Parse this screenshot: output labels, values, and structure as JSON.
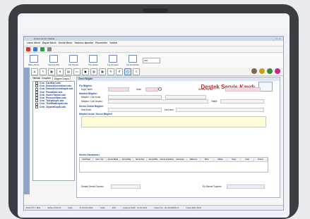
{
  "window": {
    "title": "Destek Servis Modülü",
    "controls": "_ □ ×"
  },
  "menu": [
    "Uzem Menü",
    "Bayan Menü",
    "Servis Menü",
    "Yardımcı İşlemler",
    "Pencereler",
    "Yardım"
  ],
  "ribbon": [
    {
      "label": "BEC-AŞ Aç",
      "icon": "open-icon"
    },
    {
      "label": "Fiş Kayıt/Sil",
      "icon": "record-icon"
    },
    {
      "label": "Fiş Kaydet",
      "icon": "save-icon"
    },
    {
      "label": "Fiş Listele",
      "icon": "list-icon"
    },
    {
      "label": "Fiş Sorgula",
      "icon": "query-icon"
    },
    {
      "label": "Fiş Görüntüle",
      "icon": "view-icon"
    }
  ],
  "ribbon_select": "200",
  "tabs": [
    "Tablolar",
    "Dosyalar",
    "Dizgem Dosya"
  ],
  "explorer": {
    "header": "",
    "files": [
      "Crm_CariKart.xds",
      "Crm_DestekServisKart.xds",
      "Crm_DestekServisKaydi.xds",
      "Crm_FirmaKart.xds",
      "Crm_GorevTanimi.xds",
      "Crm_PersonelKart.xds",
      "Crm_TalepKaydi.xds",
      "Crm_TeklifSatKaydi.xds",
      "Crm_ZiyaretKaydi.xds"
    ]
  },
  "form": {
    "header": "Genel Bilgiler",
    "title": "Destek Servis Kaydı",
    "sections": {
      "fis": "Fiş Bilgileri",
      "musteri": "Müşteri Bilgileri",
      "servis": "Servis Ürünü Bilgileri",
      "aciklama": "Müşteri Arıza / Sorun Bilgileri",
      "hareket": "Servis Hareketleri"
    },
    "labels": {
      "kayit_tarihi": "Kayıt Tarihi",
      "saat": "Saat",
      "servis_fis_no": "Servis Fiş No",
      "musteri_cari": "Müşteri / Cari Kodu",
      "musteri_unvan": "Müşteri / Cari Ünvanı",
      "yetkili": "Yetkili",
      "kart_kodu": "Kart Kodu",
      "kart_isim": "Kart İsmi",
      "durum": "Destek Servis Durumu",
      "toplam": "Ek Hizmet Toplamı"
    },
    "table_headers": [
      "Tarih/Saat",
      "İşlem Tipi",
      "Servis Başla",
      "Servis Bitiş",
      "Servis Alış",
      "Servis Bitiş",
      "Servis Açıklama",
      "Harcanan",
      "Malzeme",
      "Birim",
      "Miktar",
      "Fiyat",
      "Tutar",
      "Durum"
    ]
  },
  "status": [
    "ESK-STI 1. Bilet",
    "SANA.CON.C3",
    "Şube",
    "6.4.04.04.2022",
    "Yetkin",
    "ETA",
    "Çalışma Tarihi : 12.04.2022",
    "Lisans No : H1-48-930001-4",
    "Lisans Bitiş Tarihi"
  ],
  "colors": {
    "accent": "#1a4aa8",
    "title": "#d02020",
    "ribbon_border": "#6a86b8"
  }
}
